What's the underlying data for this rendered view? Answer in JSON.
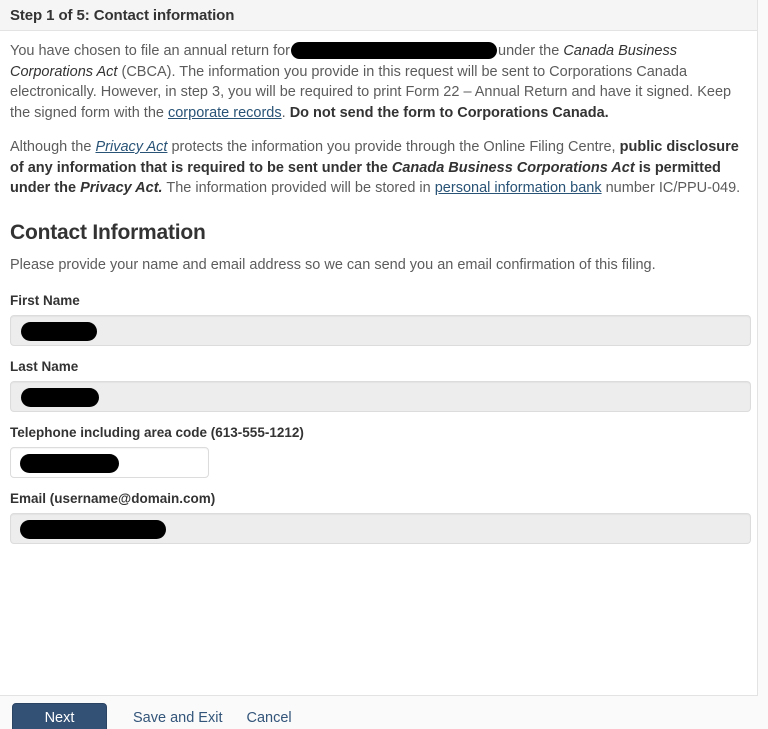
{
  "panel": {
    "header_title": "Step 1 of 5: Contact information"
  },
  "intro": {
    "p1": {
      "s1": "You have chosen to file an annual return for",
      "s2": "under the ",
      "act_italic_1": "Canada Business Corporations Act",
      "s3": " (CBCA). The information you provide in this request will be sent to Corporations Canada electronically. However, in step 3, you will be required to print Form 22 – Annual Return and have it signed. Keep the signed form with the ",
      "link_corporate_records": "corporate records",
      "s4": ". ",
      "bold_warning": "Do not send the form to Corporations Canada."
    },
    "p2": {
      "s1": "Although the ",
      "link_privacy_act": "Privacy Act",
      "s2": " protects the information you provide through the Online Filing Centre, ",
      "bold_1": "public disclosure of any information that is required to be sent under the ",
      "bold_italic_act": "Canada Business Corporations Act",
      "bold_2": " is permitted under the ",
      "bold_italic_privacy": "Privacy Act.",
      "s3": " The information provided will be stored in ",
      "link_pib": "personal information bank",
      "s4": " number IC/PPU-049."
    }
  },
  "contact_section": {
    "title": "Contact Information",
    "description": "Please provide your name and email address so we can send you an email confirmation of this filing.",
    "fields": [
      {
        "label": "First Name",
        "value": "",
        "redacted": true
      },
      {
        "label": "Last Name",
        "value": "",
        "redacted": true
      },
      {
        "label": "Telephone including area code (613-555-1212)",
        "value": "",
        "redacted": true
      },
      {
        "label": "Email (username@domain.com)",
        "value": "",
        "redacted": true
      }
    ]
  },
  "footer": {
    "next_label": "Next",
    "save_and_exit_label": "Save and Exit",
    "cancel_label": "Cancel"
  },
  "colors": {
    "primary_button": "#335075",
    "link": "#295376",
    "header_bg": "#f5f5f5",
    "input_bg": "#ededed",
    "text": "#5c5c5c"
  }
}
